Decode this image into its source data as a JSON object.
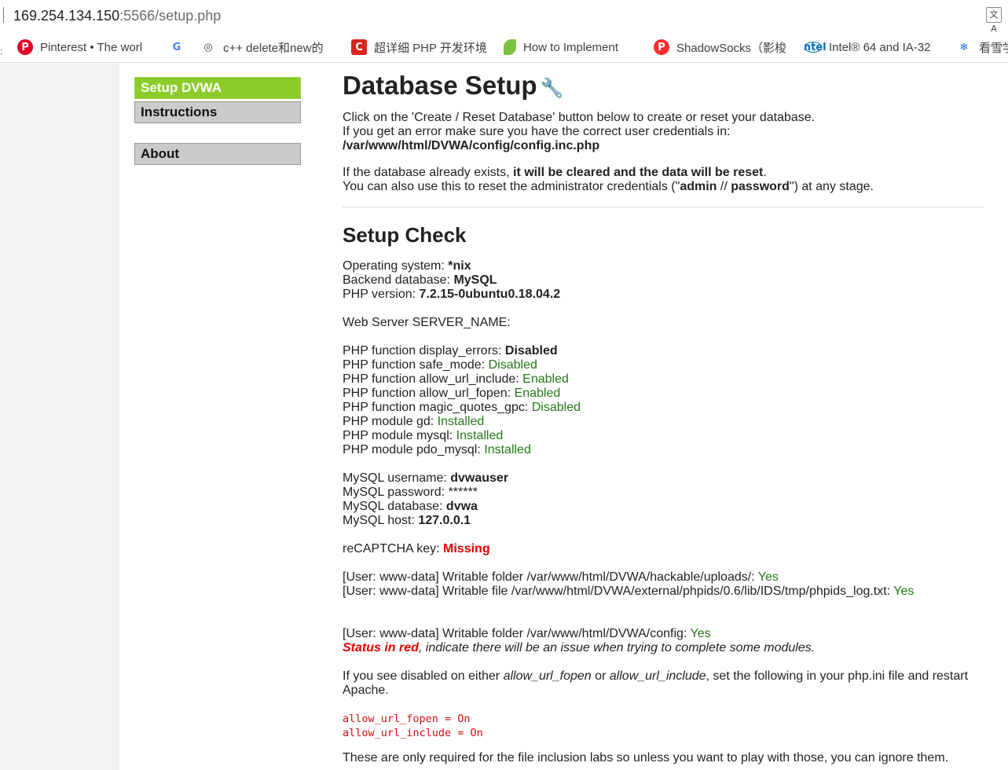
{
  "browser": {
    "url_host": "169.254.134.150",
    "url_path": ":5566/setup.php",
    "translate_icon": "translate-icon",
    "bookmarks": [
      {
        "icon": "pinterest-icon",
        "glyph": "P",
        "label": "Pinterest • The worl"
      },
      {
        "icon": "google-icon",
        "glyph": "G",
        "label": ""
      },
      {
        "icon": "cpp-icon",
        "glyph": "◎",
        "label": "c++ delete和new的"
      },
      {
        "icon": "csdn-icon",
        "glyph": "C",
        "label": "超详细 PHP 开发环境"
      },
      {
        "icon": "leaf-icon",
        "glyph": "",
        "label": "How to Implement"
      },
      {
        "icon": "shadowsocks-icon",
        "glyph": "P",
        "label": "ShadowSocks（影梭"
      },
      {
        "icon": "intel-icon",
        "glyph": "intel",
        "label": "Intel® 64 and IA-32"
      },
      {
        "icon": "snowflake-icon",
        "glyph": "❄",
        "label": "看雪学"
      }
    ]
  },
  "menu": {
    "setup": "Setup DVWA",
    "instructions": "Instructions",
    "about": "About"
  },
  "main": {
    "title": "Database Setup",
    "intro1": "Click on the 'Create / Reset Database' button below to create or reset your database.",
    "intro2": "If you get an error make sure you have the correct user credentials in:",
    "config_path": "/var/www/html/DVWA/config/config.inc.php",
    "exists_prefix": "If the database already exists, ",
    "exists_bold": "it will be cleared and the data will be reset",
    "exists_suffix": ".",
    "reset_prefix": "You can also use this to reset the administrator credentials (\"",
    "reset_admin": "admin",
    "reset_sep": " // ",
    "reset_password": "password",
    "reset_suffix": "\") at any stage.",
    "check_title": "Setup Check",
    "os_label": "Operating system: ",
    "os_value": "*nix",
    "db_label": "Backend database: ",
    "db_value": "MySQL",
    "php_label": "PHP version: ",
    "php_value": "7.2.15-0ubuntu0.18.04.2",
    "server_name_label": "Web Server SERVER_NAME:",
    "display_errors_label": "PHP function display_errors: ",
    "display_errors_value": "Disabled",
    "safe_mode_label": "PHP function safe_mode: ",
    "safe_mode_value": "Disabled",
    "allow_url_include_label": "PHP function allow_url_include: ",
    "allow_url_include_value": "Enabled",
    "allow_url_fopen_label": "PHP function allow_url_fopen: ",
    "allow_url_fopen_value": "Enabled",
    "magic_quotes_label": "PHP function magic_quotes_gpc: ",
    "magic_quotes_value": "Disabled",
    "gd_label": "PHP module gd: ",
    "gd_value": "Installed",
    "mysql_label": "PHP module mysql: ",
    "mysql_value": "Installed",
    "pdo_label": "PHP module pdo_mysql: ",
    "pdo_value": "Installed",
    "mysql_user_label": "MySQL username: ",
    "mysql_user_value": "dvwauser",
    "mysql_pass_label": "MySQL password: ",
    "mysql_pass_value": "******",
    "mysql_db_label": "MySQL database: ",
    "mysql_db_value": "dvwa",
    "mysql_host_label": "MySQL host: ",
    "mysql_host_value": "127.0.0.1",
    "recaptcha_label": "reCAPTCHA key: ",
    "recaptcha_value": "Missing",
    "uploads_label": "[User: www-data] Writable folder /var/www/html/DVWA/hackable/uploads/: ",
    "uploads_value": "Yes",
    "phpids_label": "[User: www-data] Writable file /var/www/html/DVWA/external/phpids/0.6/lib/IDS/tmp/phpids_log.txt: ",
    "phpids_value": "Yes",
    "config_label": "[User: www-data] Writable folder /var/www/html/DVWA/config: ",
    "config_value": "Yes",
    "status_red": "Status in red",
    "status_suffix": ", indicate there will be an issue when trying to complete some modules.",
    "disabled_prefix": "If you see disabled on either ",
    "disabled_fopen": "allow_url_fopen",
    "disabled_or": " or ",
    "disabled_include": "allow_url_include",
    "disabled_suffix": ", set the following in your php.ini file and restart",
    "disabled_line2": "Apache.",
    "code1": "allow_url_fopen = On",
    "code2": "allow_url_include = On",
    "footer_note": "These are only required for the file inclusion labs so unless you want to play with those, you can ignore them."
  },
  "colors": {
    "selected_menu": "#8dcb2b",
    "menu": "#cbcbcb",
    "ok_green": "#227a15",
    "error_red": "#e20000",
    "code_red": "#cc1111"
  }
}
